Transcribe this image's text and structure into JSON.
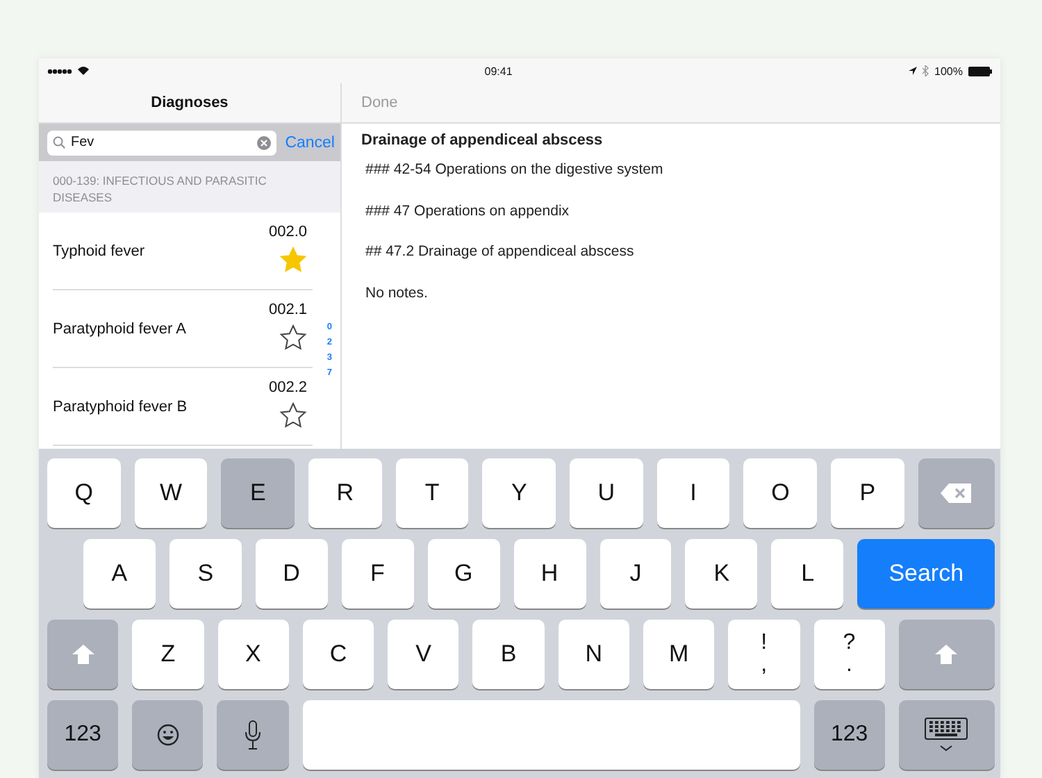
{
  "status_bar": {
    "time": "09:41",
    "battery": "100%"
  },
  "sidebar": {
    "title": "Diagnoses",
    "search": {
      "value": "Fev",
      "cancel": "Cancel"
    },
    "section": "000-139: INFECTIOUS AND PARASITIC DISEASES",
    "items": [
      {
        "name": "Typhoid fever",
        "code": "002.0",
        "starred": true
      },
      {
        "name": "Paratyphoid fever A",
        "code": "002.1",
        "starred": false
      },
      {
        "name": "Paratyphoid fever B",
        "code": "002.2",
        "starred": false
      }
    ],
    "index": [
      "0",
      "2",
      "3",
      "7"
    ]
  },
  "detail": {
    "done": {
      "label": "Done",
      "disabled": true
    },
    "title": "Drainage of appendiceal abscess",
    "lines": [
      "### 42-54 Operations on the digestive system",
      "### 47 Operations on appendix",
      "## 47.2 Drainage of appendiceal abscess",
      "No notes."
    ]
  },
  "keyboard": {
    "rows": [
      [
        {
          "kind": "letter",
          "label": "Q",
          "pressed": false
        },
        {
          "kind": "letter",
          "label": "W",
          "pressed": false
        },
        {
          "kind": "letter",
          "label": "E",
          "pressed": true
        },
        {
          "kind": "letter",
          "label": "R",
          "pressed": false
        },
        {
          "kind": "letter",
          "label": "T",
          "pressed": false
        },
        {
          "kind": "letter",
          "label": "Y",
          "pressed": false
        },
        {
          "kind": "letter",
          "label": "U",
          "pressed": false
        },
        {
          "kind": "letter",
          "label": "I",
          "pressed": false
        },
        {
          "kind": "letter",
          "label": "O",
          "pressed": false
        },
        {
          "kind": "letter",
          "label": "P",
          "pressed": false
        },
        {
          "kind": "backspace"
        }
      ],
      [
        {
          "kind": "letter",
          "label": "A",
          "pressed": false
        },
        {
          "kind": "letter",
          "label": "S",
          "pressed": false
        },
        {
          "kind": "letter",
          "label": "D",
          "pressed": false
        },
        {
          "kind": "letter",
          "label": "F",
          "pressed": false
        },
        {
          "kind": "letter",
          "label": "G",
          "pressed": false
        },
        {
          "kind": "letter",
          "label": "H",
          "pressed": false
        },
        {
          "kind": "letter",
          "label": "J",
          "pressed": false
        },
        {
          "kind": "letter",
          "label": "K",
          "pressed": false
        },
        {
          "kind": "letter",
          "label": "L",
          "pressed": false
        },
        {
          "kind": "action",
          "label": "Search"
        }
      ],
      [
        {
          "kind": "shift"
        },
        {
          "kind": "letter",
          "label": "Z",
          "pressed": false
        },
        {
          "kind": "letter",
          "label": "X",
          "pressed": false
        },
        {
          "kind": "letter",
          "label": "C",
          "pressed": false
        },
        {
          "kind": "letter",
          "label": "V",
          "pressed": false
        },
        {
          "kind": "letter",
          "label": "B",
          "pressed": false
        },
        {
          "kind": "letter",
          "label": "N",
          "pressed": false
        },
        {
          "kind": "letter",
          "label": "M",
          "pressed": false
        },
        {
          "kind": "punct",
          "top": "!",
          "bottom": ","
        },
        {
          "kind": "punct",
          "top": "?",
          "bottom": "."
        },
        {
          "kind": "shift"
        }
      ],
      [
        {
          "kind": "mode",
          "label": "123"
        },
        {
          "kind": "emoji"
        },
        {
          "kind": "mic"
        },
        {
          "kind": "space"
        },
        {
          "kind": "mode",
          "label": "123"
        },
        {
          "kind": "dismiss"
        }
      ]
    ]
  }
}
